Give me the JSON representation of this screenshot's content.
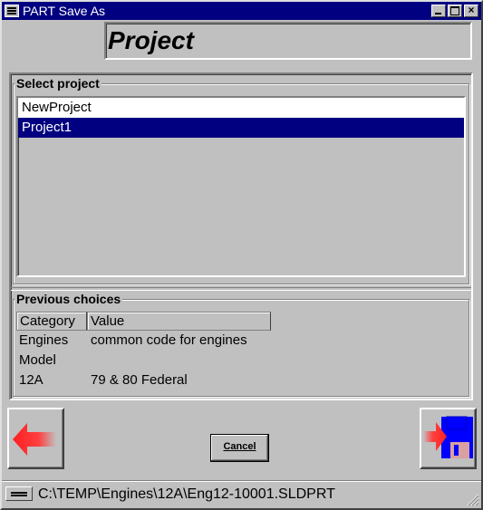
{
  "window": {
    "title": "PART Save As"
  },
  "header": {
    "title": "Project"
  },
  "select_project": {
    "label": "Select project",
    "items": [
      {
        "label": "NewProject",
        "selected": false
      },
      {
        "label": "Project1",
        "selected": true
      }
    ]
  },
  "previous_choices": {
    "label": "Previous choices",
    "columns": [
      "Category",
      "Value"
    ],
    "rows": [
      [
        "Engines",
        "common code for engines"
      ],
      [
        "Model",
        ""
      ],
      [
        "12A",
        "79 & 80 Federal"
      ]
    ]
  },
  "buttons": {
    "back_icon": "red-left-arrow-icon",
    "cancel_label": "Cancel",
    "save_icon": "save-arrow-disk-icon"
  },
  "status": {
    "path": "C:\\TEMP\\Engines\\12A\\Eng12-10001.SLDPRT"
  },
  "colors": {
    "titlebar": "#000080",
    "selection": "#000080",
    "background": "#c0c0c0",
    "arrow": "#ff3030",
    "disk": "#0000ff"
  }
}
